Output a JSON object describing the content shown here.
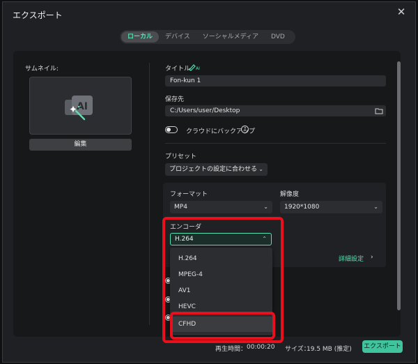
{
  "dialog": {
    "title": "エクスポート"
  },
  "tabs": [
    {
      "label": "ローカル",
      "active": true
    },
    {
      "label": "デバイス",
      "active": false
    },
    {
      "label": "ソーシャルメディア",
      "active": false
    },
    {
      "label": "DVD",
      "active": false
    }
  ],
  "thumbnail": {
    "label": "サムネイル:",
    "edit_label": "編集",
    "icon": "ai-magic-icon"
  },
  "title_field": {
    "label": "タイトル",
    "value": "Fon-kun 1",
    "ai_badge": "AI"
  },
  "save_to": {
    "label": "保存先",
    "value": "C:/Users/user/Desktop"
  },
  "cloud_backup": {
    "label": "クラウドにバックアップ",
    "enabled": false,
    "help": "?"
  },
  "preset": {
    "label": "プリセット",
    "value": "プロジェクトの設定に合わせる"
  },
  "format": {
    "label": "フォーマット",
    "value": "MP4"
  },
  "resolution": {
    "label": "解像度",
    "value": "1920*1080"
  },
  "encoder": {
    "label": "エンコーダ",
    "value": "H.264",
    "options": [
      "H.264",
      "MPEG-4",
      "AV1",
      "HEVC",
      "CFHD"
    ],
    "highlighted": "CFHD"
  },
  "advanced": {
    "label": "詳細設定",
    "chevron": "›"
  },
  "footer": {
    "duration_label": "再生時間：",
    "duration_value": "00:00:20",
    "size_label": "サイズ：",
    "size_value": "19.5 MB (推定)",
    "export_label": "エクスポート"
  },
  "colors": {
    "accent": "#58e0b0",
    "export_button": "#3fc49d",
    "annotation": "#e8101c"
  }
}
